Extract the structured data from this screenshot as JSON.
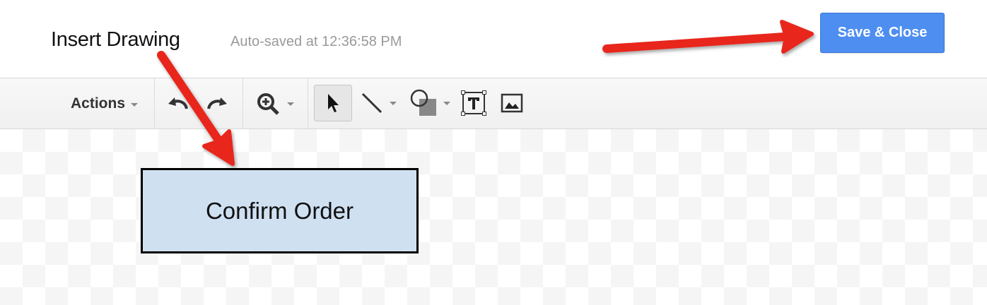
{
  "header": {
    "title": "Insert Drawing",
    "autosave": "Auto-saved at 12:36:58 PM",
    "save_label": "Save & Close"
  },
  "toolbar": {
    "actions_label": "Actions",
    "tools": [
      "undo-icon",
      "redo-icon",
      "zoom-icon",
      "select-icon",
      "line-icon",
      "shape-icon",
      "text-box-icon",
      "image-icon"
    ]
  },
  "canvas": {
    "shape_text": "Confirm Order",
    "shape_fill": "#cfe0f1"
  },
  "annotations": {
    "arrow_color": "#e8281b"
  },
  "colors": {
    "primary_button": "#4d8ef0"
  }
}
